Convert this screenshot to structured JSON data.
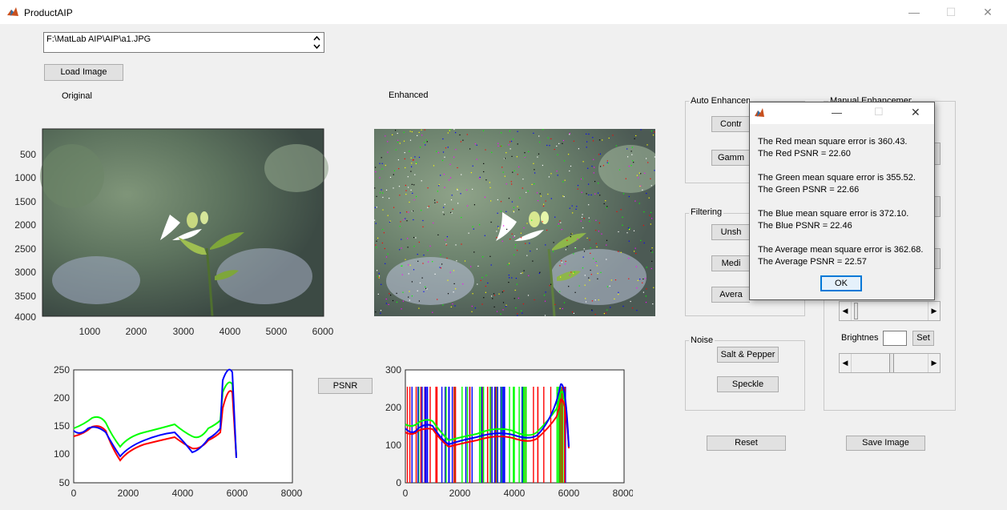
{
  "window": {
    "title": "ProductAIP",
    "minimize": "—",
    "maximize": "☐",
    "close": "✕"
  },
  "file_path": "F:\\MatLab AIP\\AIP\\a1.JPG",
  "buttons": {
    "load_image": "Load Image",
    "psnr": "PSNR",
    "contrast": "Contr",
    "gamma": "Gamm",
    "unsharp": "Unsh",
    "median": "Medi",
    "average": "Avera",
    "salt_pepper": "Salt & Pepper",
    "speckle": "Speckle",
    "reset": "Reset",
    "save_image": "Save Image",
    "set": "Set"
  },
  "labels": {
    "original": "Original",
    "enhanced": "Enhanced",
    "brightness": "Brightnes"
  },
  "panels": {
    "auto": "Auto Enhancement",
    "manual": "Manual Enhancement",
    "filtering": "Filtering",
    "noise": "Noise"
  },
  "image_axes": {
    "y_ticks": [
      "500",
      "1000",
      "1500",
      "2000",
      "2500",
      "3000",
      "3500",
      "4000"
    ],
    "x_ticks": [
      "1000",
      "2000",
      "3000",
      "4000",
      "5000",
      "6000"
    ]
  },
  "histogram_left": {
    "y_ticks": [
      "250",
      "200",
      "150",
      "100",
      "50"
    ],
    "x_ticks": [
      "0",
      "2000",
      "4000",
      "6000",
      "8000"
    ]
  },
  "histogram_right": {
    "y_ticks": [
      "300",
      "200",
      "100",
      "0"
    ],
    "x_ticks": [
      "0",
      "2000",
      "4000",
      "6000",
      "8000"
    ]
  },
  "colors": {
    "red": "#ff0000",
    "green": "#00ff00",
    "blue": "#0000ff"
  },
  "dialog": {
    "lines": [
      "The Red mean square error is 360.43.",
      "The Red PSNR = 22.60",
      "The Green mean square error is 355.52.",
      "The Green PSNR = 22.66",
      "The Blue mean square error is 372.10.",
      "The Blue PSNR = 22.46",
      "The Average mean square error is 362.68.",
      "The Average PSNR = 22.57"
    ],
    "ok": "OK",
    "minimize": "—",
    "maximize": "☐",
    "close": "✕"
  }
}
